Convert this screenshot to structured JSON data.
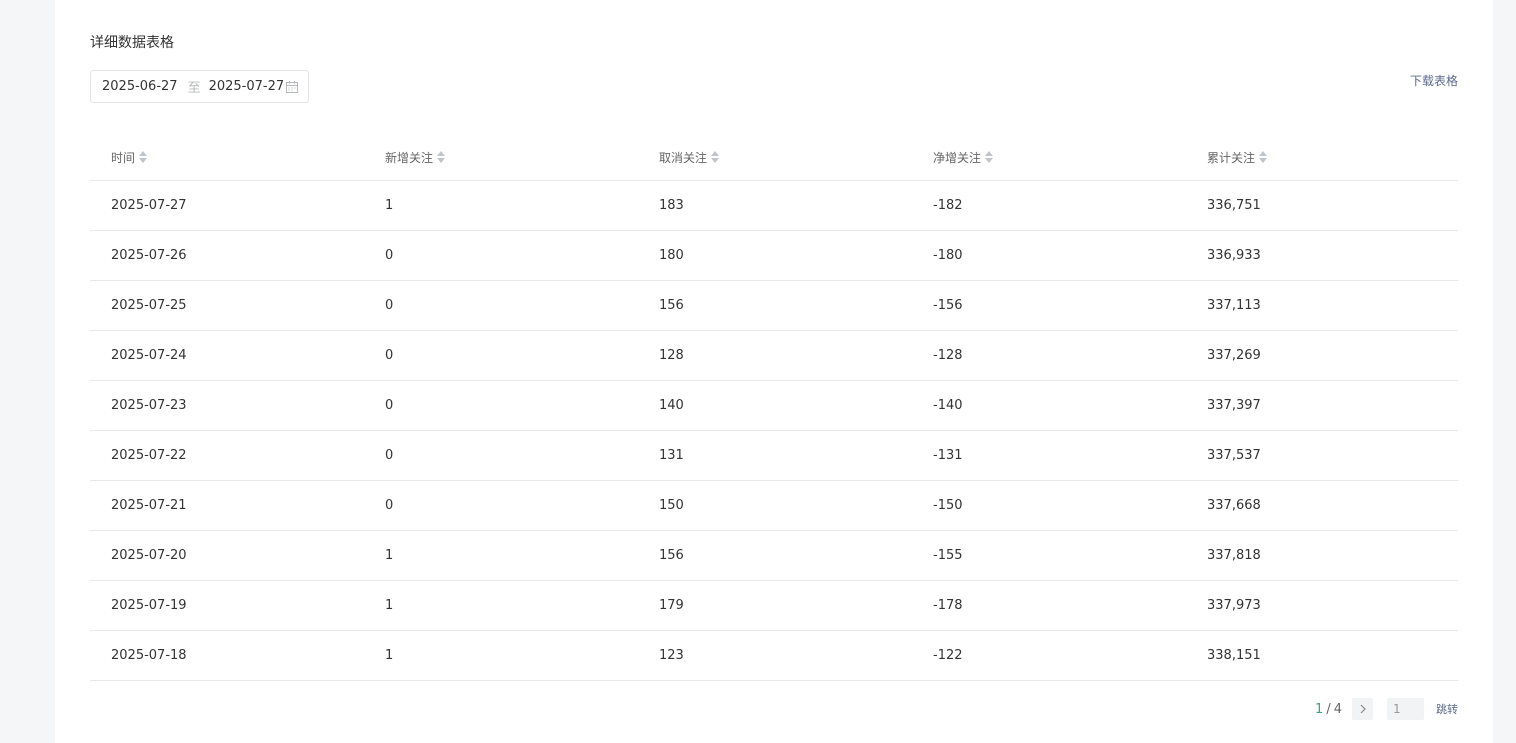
{
  "section": {
    "title": "详细数据表格",
    "download_label": "下载表格"
  },
  "date_range": {
    "start": "2025-06-27",
    "separator": "至",
    "end": "2025-07-27",
    "icon": "calendar-icon"
  },
  "table": {
    "columns": [
      "时间",
      "新增关注",
      "取消关注",
      "净增关注",
      "累计关注"
    ],
    "rows": [
      [
        "2025-07-27",
        "1",
        "183",
        "-182",
        "336,751"
      ],
      [
        "2025-07-26",
        "0",
        "180",
        "-180",
        "336,933"
      ],
      [
        "2025-07-25",
        "0",
        "156",
        "-156",
        "337,113"
      ],
      [
        "2025-07-24",
        "0",
        "128",
        "-128",
        "337,269"
      ],
      [
        "2025-07-23",
        "0",
        "140",
        "-140",
        "337,397"
      ],
      [
        "2025-07-22",
        "0",
        "131",
        "-131",
        "337,537"
      ],
      [
        "2025-07-21",
        "0",
        "150",
        "-150",
        "337,668"
      ],
      [
        "2025-07-20",
        "1",
        "156",
        "-155",
        "337,818"
      ],
      [
        "2025-07-19",
        "1",
        "179",
        "-178",
        "337,973"
      ],
      [
        "2025-07-18",
        "1",
        "123",
        "-122",
        "338,151"
      ]
    ]
  },
  "pagination": {
    "current": "1",
    "total": "4",
    "jump_value": "1",
    "jump_label": "跳转",
    "accent_color": "#3aa57a"
  }
}
